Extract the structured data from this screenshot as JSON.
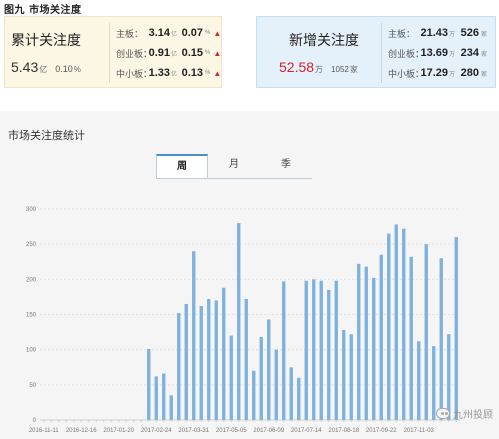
{
  "figure_caption": "图九  市场关注度",
  "left_panel": {
    "title": "累计关注度",
    "total_value": "5.43",
    "total_unit": "亿",
    "total_pct": "0.10",
    "total_pct_unit": "%",
    "rows": [
      {
        "label": "主板：",
        "value": "3.14",
        "unit": "亿",
        "pct": "0.07",
        "pct_unit": "%",
        "arrow": "▲"
      },
      {
        "label": "创业板：",
        "value": "0.91",
        "unit": "亿",
        "pct": "0.15",
        "pct_unit": "%",
        "arrow": "▲"
      },
      {
        "label": "中小板：",
        "value": "1.33",
        "unit": "亿",
        "pct": "0.13",
        "pct_unit": "%",
        "arrow": "▲"
      }
    ]
  },
  "right_panel": {
    "title": "新增关注度",
    "total_value": "52.58",
    "total_unit": "万",
    "count": "1052",
    "count_unit": "家",
    "rows": [
      {
        "label": "主板：",
        "value": "21.43",
        "unit": "万",
        "count": "526",
        "count_unit": "家"
      },
      {
        "label": "创业板：",
        "value": "13.69",
        "unit": "万",
        "count": "234",
        "count_unit": "家"
      },
      {
        "label": "中小板：",
        "value": "17.29",
        "unit": "万",
        "count": "280",
        "count_unit": "家"
      }
    ]
  },
  "chart_section_title": "市场关注度统计",
  "tabs": [
    "周",
    "月",
    "季"
  ],
  "active_tab": 0,
  "watermark": "九州投顾",
  "colors": {
    "bar": "#7fb1dd",
    "arrow_up": "#d62b2b",
    "new_total": "#d02424"
  },
  "chart_data": {
    "type": "bar",
    "ylim": [
      0,
      300
    ],
    "yticks": [
      0,
      50,
      100,
      150,
      200,
      250,
      300
    ],
    "grid": true,
    "xtick_labels": [
      "2016-11-11",
      "2016-12-16",
      "2017-01-20",
      "2017-02-24",
      "2017-03-31",
      "2017-05-05",
      "2017-06-09",
      "2017-07-14",
      "2017-08-18",
      "2017-09-22",
      "2017-11-03"
    ],
    "values": [
      0,
      0,
      0,
      0,
      0,
      0,
      0,
      0,
      0,
      0,
      0,
      0,
      0,
      0,
      101,
      62,
      66,
      35,
      152,
      165,
      240,
      162,
      172,
      170,
      188,
      120,
      280,
      172,
      70,
      118,
      143,
      100,
      197,
      75,
      60,
      198,
      200,
      198,
      185,
      198,
      128,
      122,
      222,
      218,
      202,
      235,
      265,
      278,
      272,
      232,
      112,
      250,
      105,
      230,
      122,
      260
    ]
  }
}
